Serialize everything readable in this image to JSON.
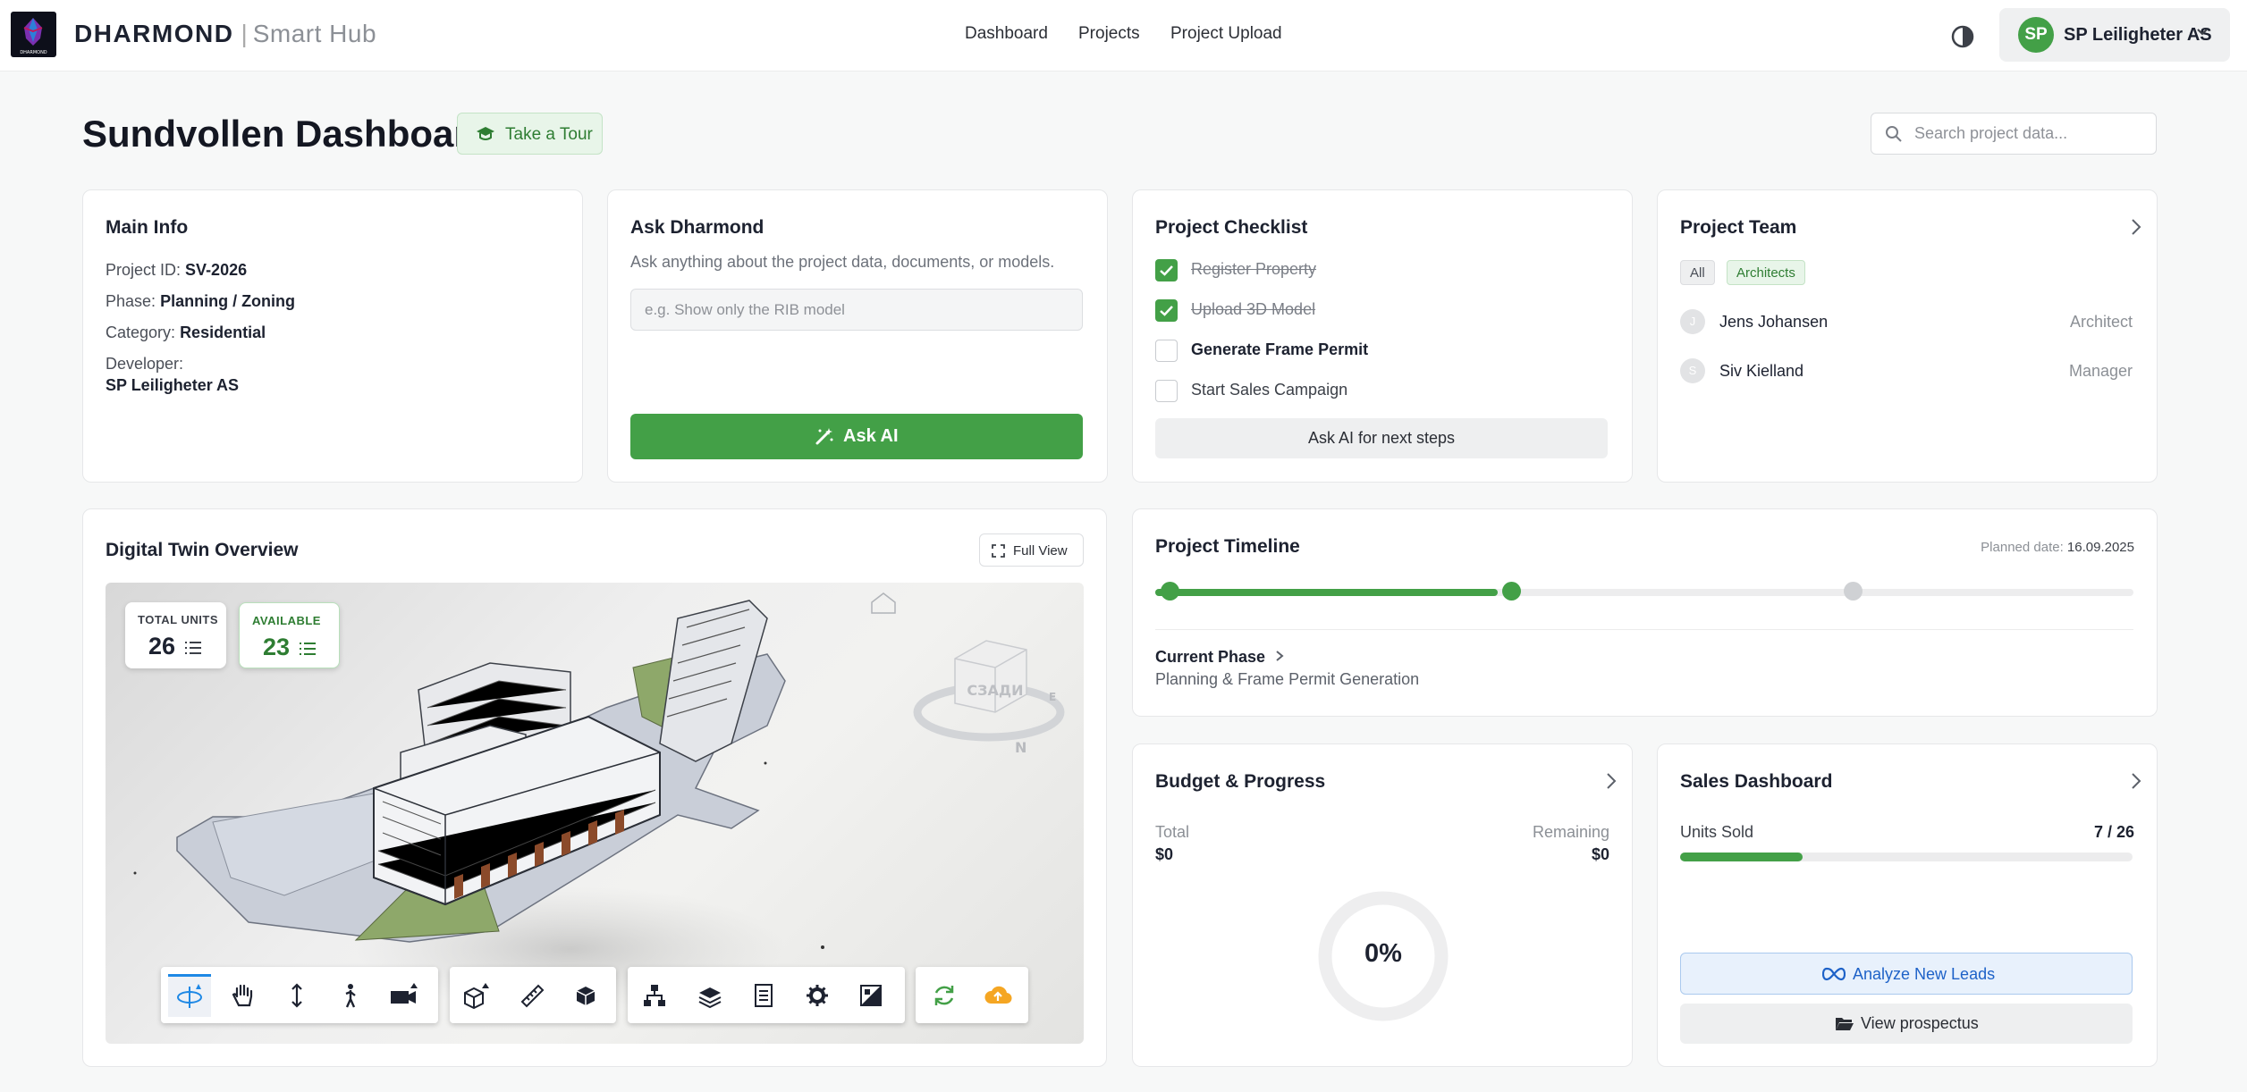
{
  "app": {
    "brand_name": "DHARMOND",
    "brand_sep": "|",
    "brand_sub": "Smart Hub",
    "logo_text": "DHARMOND"
  },
  "nav": {
    "items": [
      {
        "label": "Dashboard"
      },
      {
        "label": "Projects"
      },
      {
        "label": "Project Upload"
      }
    ]
  },
  "user": {
    "initials": "SP",
    "name": "SP Leiligheter AS",
    "avatar_color": "#43a047"
  },
  "page": {
    "title": "Sundvollen Dashboard",
    "tour_label": "Take a Tour",
    "search_placeholder": "Search project data..."
  },
  "main_info": {
    "title": "Main Info",
    "project_id_label": "Project ID:",
    "project_id": "SV-2026",
    "phase_label": "Phase:",
    "phase": "Planning / Zoning",
    "category_label": "Category:",
    "category": "Residential",
    "developer_label": "Developer:",
    "developer": "SP Leiligheter AS"
  },
  "ask": {
    "title": "Ask Dharmond",
    "subtitle": "Ask anything about the project data, documents, or models.",
    "placeholder": "e.g. Show only the RIB model",
    "button_label": "Ask AI"
  },
  "checklist": {
    "title": "Project Checklist",
    "items": [
      {
        "label": "Register Property",
        "done": true
      },
      {
        "label": "Upload 3D Model",
        "done": true
      },
      {
        "label": "Generate Frame Permit",
        "done": false
      },
      {
        "label": "Start Sales Campaign",
        "done": false
      }
    ],
    "next_steps_label": "Ask AI for next steps"
  },
  "team": {
    "title": "Project Team",
    "filters": [
      {
        "label": "All"
      },
      {
        "label": "Architects"
      }
    ],
    "members": [
      {
        "initial": "J",
        "name": "Jens Johansen",
        "role": "Architect"
      },
      {
        "initial": "S",
        "name": "Siv Kielland",
        "role": "Manager"
      }
    ]
  },
  "twin": {
    "title": "Digital Twin Overview",
    "full_view_label": "Full View",
    "total_units_label": "TOTAL UNITS",
    "total_units": "26",
    "available_label": "AVAILABLE",
    "available": "23",
    "navcube_label": "СЗАДИ",
    "compass_n": "N",
    "compass_e": "E",
    "toolbar_icons": [
      "orbit-icon",
      "pan-hand-icon",
      "zoom-icon",
      "first-person-icon",
      "camera-icon",
      "section-box-icon",
      "measure-icon",
      "explode-icon",
      "model-tree-icon",
      "layers-icon",
      "properties-icon",
      "settings-icon",
      "render-mode-icon",
      "refresh-icon",
      "upload-cloud-icon"
    ]
  },
  "timeline": {
    "title": "Project Timeline",
    "planned_label": "Planned date:",
    "planned_date": "16.09.2025",
    "progress": 0.35,
    "current_phase_label": "Current Phase",
    "current_phase": "Planning & Frame Permit Generation"
  },
  "budget": {
    "title": "Budget & Progress",
    "total_label": "Total",
    "total": "$0",
    "remaining_label": "Remaining",
    "remaining": "$0",
    "percent": "0%"
  },
  "sales": {
    "title": "Sales Dashboard",
    "units_sold_label": "Units Sold",
    "units_sold": "7 / 26",
    "sold_fraction": 0.27,
    "leads_label": "Analyze New Leads",
    "prospectus_label": "View prospectus"
  },
  "colors": {
    "accent": "#43a047",
    "blue": "#1e62c8",
    "orange": "#f5a623"
  }
}
